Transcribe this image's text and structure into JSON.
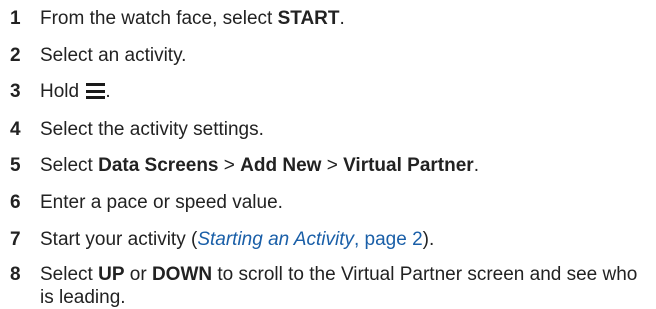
{
  "steps": [
    {
      "num": "1",
      "t1": "From the watch face, select ",
      "b1": "START",
      "t2": "."
    },
    {
      "num": "2",
      "t1": "Select an activity."
    },
    {
      "num": "3",
      "t1": "Hold ",
      "icon": "menu-icon",
      "t2": "."
    },
    {
      "num": "4",
      "t1": "Select the activity settings."
    },
    {
      "num": "5",
      "t1": "Select ",
      "b1": "Data Screens",
      "t2": " > ",
      "b2": "Add New",
      "t3": " > ",
      "b3": "Virtual Partner",
      "t4": "."
    },
    {
      "num": "6",
      "t1": "Enter a pace or speed value."
    },
    {
      "num": "7",
      "t1": "Start your activity (",
      "link_title": "Starting an Activity",
      "link_page": ", page 2",
      "t2": ")."
    },
    {
      "num": "8",
      "t1": "Select ",
      "b1": "UP",
      "t2": " or ",
      "b2": "DOWN",
      "t3": " to scroll to the Virtual Partner screen and see who is leading."
    }
  ],
  "colors": {
    "text": "#222222",
    "link": "#1a5fa8"
  }
}
